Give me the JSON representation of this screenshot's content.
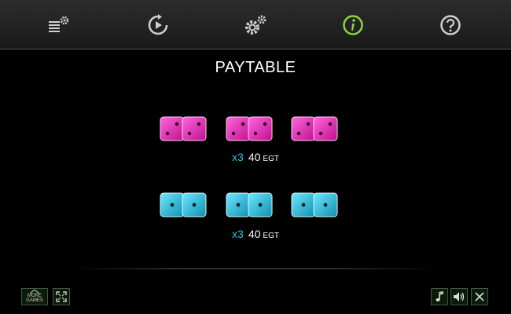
{
  "title": "PAYTABLE",
  "top_menu": [
    "settings-list-icon",
    "replay-icon",
    "gears-icon",
    "info-icon",
    "help-icon"
  ],
  "active_menu": "info-icon",
  "colors": {
    "pink": "#ff33cc",
    "cyan": "#2ad3f0",
    "active": "#8bd53b",
    "multiplier": "#27c6dc"
  },
  "paytable": [
    {
      "symbol": "pink dice pair",
      "multiplier": "x3",
      "amount": "40",
      "currency": "EGT"
    },
    {
      "symbol": "cyan dice pair",
      "multiplier": "x3",
      "amount": "40",
      "currency": "EGT"
    }
  ],
  "bottom_left": {
    "more_games_line1": "MORE",
    "more_games_line2": "GAMES"
  },
  "bottom_right": [
    "music-icon",
    "sound-icon",
    "close-icon"
  ]
}
